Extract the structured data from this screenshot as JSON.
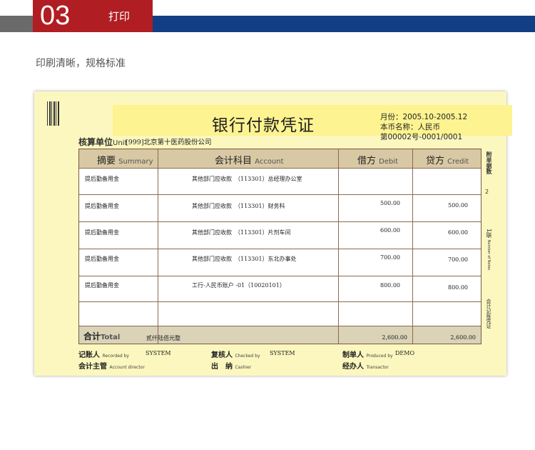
{
  "header": {
    "number": "03",
    "label": "打印"
  },
  "subtitle": "印刷清晰，规格标准",
  "voucher": {
    "title": "银行付款凭证",
    "period": "月份：2005.10-2005.12",
    "currency": "本币名称：人民币",
    "code": "第00002号-0001/0001",
    "unit_label": "核算单位",
    "unit_label_en": "Unit",
    "unit_value": "[999]北京第十医药股份公司",
    "columns": {
      "summary": "摘要",
      "summary_en": "Summary",
      "account": "会计科目",
      "account_en": "Account",
      "debit": "借方",
      "debit_en": "Debit",
      "credit": "贷方",
      "credit_en": "Credit"
    },
    "rows": [
      {
        "summary": "提后勤备用金",
        "account": "其他部门应收款　（113301）总经理办公室",
        "debit": "",
        "credit": ""
      },
      {
        "summary": "提后勤备用金",
        "account": "其他部门应收款　（113301）财务科",
        "debit": "500.00",
        "credit": "500.00"
      },
      {
        "summary": "提后勤备用金",
        "account": "其他部门应收款　（113301）片剂车间",
        "debit": "600.00",
        "credit": "600.00"
      },
      {
        "summary": "提后勤备用金",
        "account": "其他部门应收款　（113301）东北办事处",
        "debit": "700.00",
        "credit": "700.00"
      },
      {
        "summary": "提后勤备用金",
        "account": "工行-人民币账户 -01（10020101）",
        "debit": "800.00",
        "credit": "800.00"
      },
      {
        "summary": "",
        "account": "",
        "debit": "",
        "credit": ""
      }
    ],
    "total": {
      "label": "合计",
      "label_en": "Total",
      "words": "贰仟陆佰元整",
      "debit": "2,600.00",
      "credit": "2,600.00"
    },
    "attachments_label": "附单据数",
    "attachments_value": "2",
    "copy_label": "1联",
    "copy_label_en": "Number of Notes",
    "copy_side": "会计记账凭证",
    "signatures": {
      "recorded_by": "记账人",
      "recorded_by_en": "Recorded by",
      "recorded_by_value": "SYSTEM",
      "checked_by": "复核人",
      "checked_by_en": "Checked by",
      "checked_by_value": "SYSTEM",
      "produced_by": "制单人",
      "produced_by_en": "Produced by",
      "produced_by_value": "DEMO",
      "account_director": "会计主管",
      "account_director_en": "Account director",
      "cashier": "出　纳",
      "cashier_en": "Cashier",
      "transactor": "经办人",
      "transactor_en": "Transactor"
    }
  }
}
